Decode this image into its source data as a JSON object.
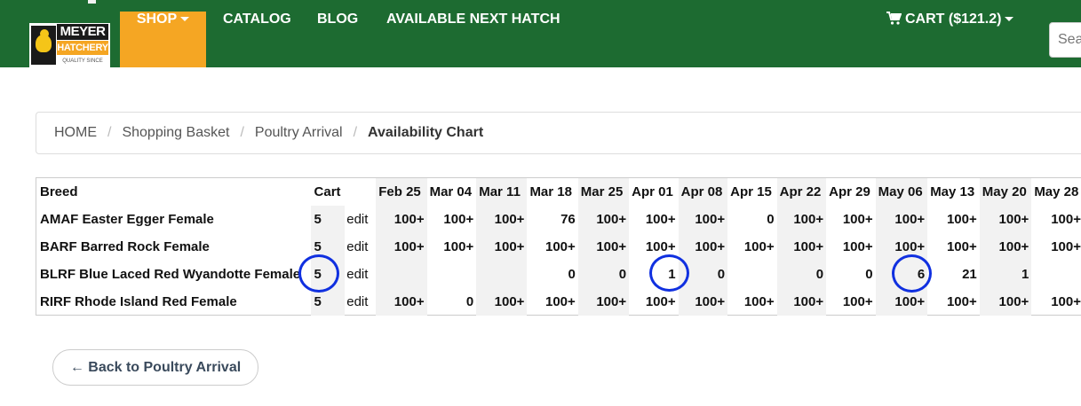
{
  "brand": {
    "logo_line1": "MEYER",
    "logo_line2": "HATCHERY",
    "logo_tagline": "QUALITY SINCE 1985"
  },
  "nav": {
    "shop": "SHOP",
    "catalog": "CATALOG",
    "blog": "BLOG",
    "hatch": "AVAILABLE NEXT HATCH",
    "cart": "CART ($121.2)",
    "search_placeholder": "Sea"
  },
  "breadcrumb": {
    "items": [
      "HOME",
      "Shopping Basket",
      "Poultry Arrival"
    ],
    "active": "Availability Chart",
    "separator": "/"
  },
  "table": {
    "headers": {
      "breed": "Breed",
      "cart": "Cart",
      "edit": "",
      "dates": [
        "Feb 25",
        "Mar 04",
        "Mar 11",
        "Mar 18",
        "Mar 25",
        "Apr 01",
        "Apr 08",
        "Apr 15",
        "Apr 22",
        "Apr 29",
        "May 06",
        "May 13",
        "May 20",
        "May 28"
      ]
    },
    "rows": [
      {
        "breed": "AMAF Easter Egger Female",
        "cart": "5",
        "edit": "edit",
        "values": [
          "100+",
          "100+",
          "100+",
          "76",
          "100+",
          "100+",
          "100+",
          "0",
          "100+",
          "100+",
          "100+",
          "100+",
          "100+",
          "100+"
        ]
      },
      {
        "breed": "BARF Barred Rock Female",
        "cart": "5",
        "edit": "edit",
        "values": [
          "100+",
          "100+",
          "100+",
          "100+",
          "100+",
          "100+",
          "100+",
          "100+",
          "100+",
          "100+",
          "100+",
          "100+",
          "100+",
          "100+"
        ]
      },
      {
        "breed": "BLRF Blue Laced Red Wyandotte Female",
        "cart": "5",
        "edit": "edit",
        "values": [
          "",
          "",
          "",
          "0",
          "0",
          "1",
          "0",
          "",
          "0",
          "0",
          "6",
          "21",
          "1",
          ""
        ]
      },
      {
        "breed": "RIRF Rhode Island Red Female",
        "cart": "5",
        "edit": "edit",
        "values": [
          "100+",
          "0",
          "100+",
          "100+",
          "100+",
          "100+",
          "100+",
          "100+",
          "100+",
          "100+",
          "100+",
          "100+",
          "100+",
          "100+"
        ]
      }
    ]
  },
  "annotation_color": "#1030e0",
  "back_button": "← Back to Poultry Arrival"
}
